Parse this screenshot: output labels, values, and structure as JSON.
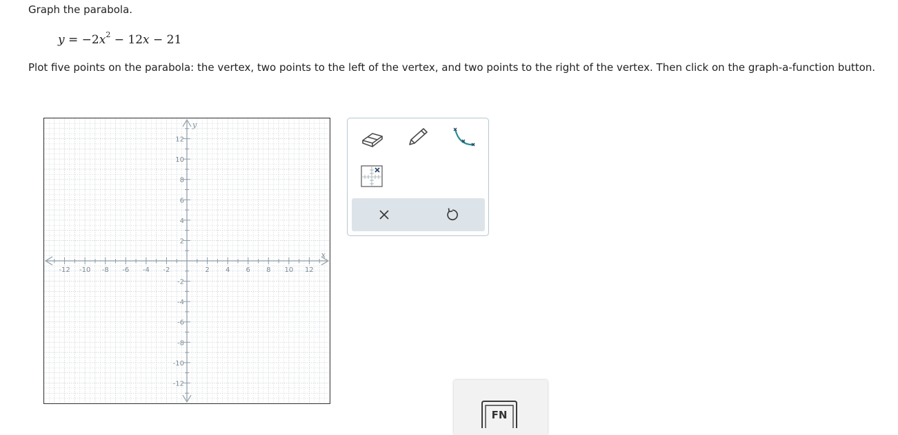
{
  "prompt": {
    "instruction": "Graph the parabola.",
    "equation": {
      "lhs": "y",
      "eq": " = ",
      "t1": "−2",
      "t1_var": "x",
      "t1_exp": "2",
      "t2": " − 12",
      "t2_var": "x",
      "t3": " − 21"
    },
    "directions": "Plot five points on the parabola: the vertex, two points to the left of the vertex, and two points to the right of the vertex. Then click on the graph-a-function button."
  },
  "graph": {
    "x_axis_label": "x",
    "y_axis_label": "y",
    "x_range": [
      -14,
      14
    ],
    "y_range": [
      -14,
      14
    ],
    "x_tick_labels": [
      "-12",
      "-10",
      "-8",
      "-6",
      "-4",
      "-2",
      "2",
      "4",
      "6",
      "8",
      "10",
      "12"
    ],
    "y_tick_labels": [
      "12",
      "10",
      "8",
      "6",
      "4",
      "2",
      "-2",
      "-4",
      "-6",
      "-8",
      "-10",
      "-12"
    ],
    "grid": true,
    "axis_color": "#8a9aa3",
    "grid_color": "#c9d1d6"
  },
  "tools": {
    "items": [
      "eraser-icon",
      "pencil-icon",
      "parabola-tool-icon",
      "point-grid-icon"
    ],
    "accent_color": "#2a8c94",
    "actions": [
      "delete-icon",
      "undo-icon"
    ]
  },
  "fn_button": {
    "label": "FN"
  }
}
